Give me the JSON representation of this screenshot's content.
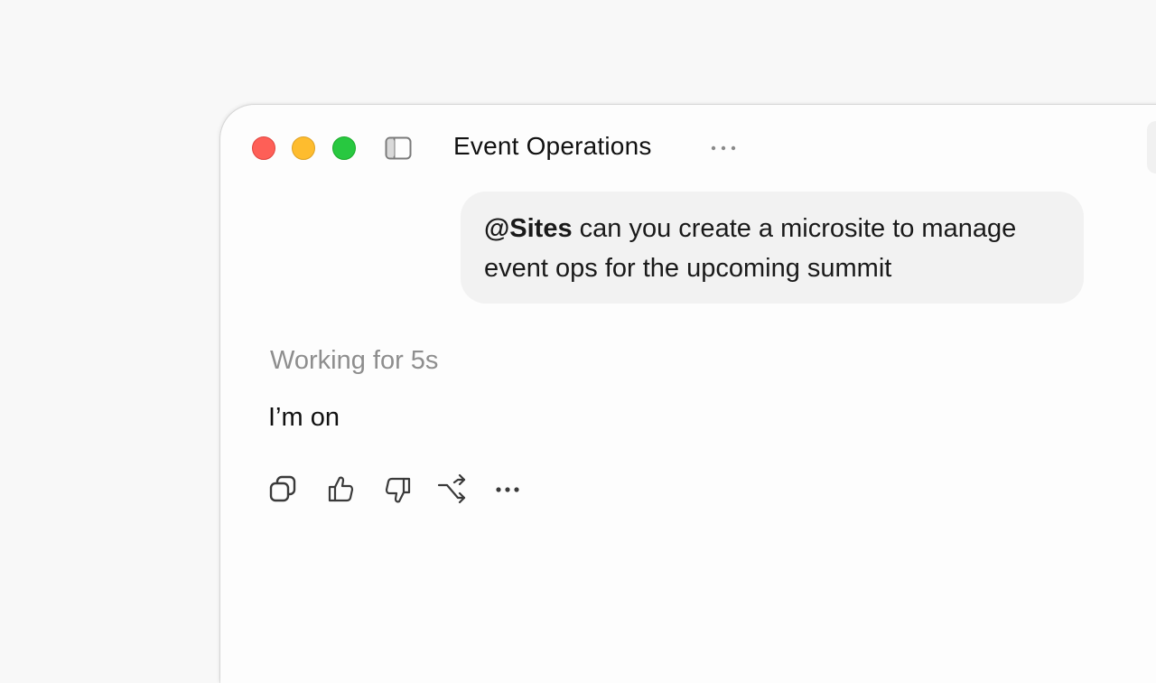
{
  "window": {
    "title": "Event Operations",
    "traffic_lights": {
      "close_color": "#fe5f57",
      "minimize_color": "#febc2e",
      "zoom_color": "#28c840"
    }
  },
  "toolbar": {
    "sidebar_toggle_icon": "sidebar-toggle-icon",
    "more_icon": "ellipsis-icon"
  },
  "conversation": {
    "user_message": {
      "mention": "@Sites",
      "text": " can you create a microsite to manage event ops for the upcoming summit"
    },
    "assistant": {
      "status": "Working for 5s",
      "reply": "I’m on"
    }
  },
  "message_actions": [
    {
      "name": "copy",
      "icon": "copy-icon"
    },
    {
      "name": "thumbs-up",
      "icon": "thumbs-up-icon"
    },
    {
      "name": "thumbs-down",
      "icon": "thumbs-down-icon"
    },
    {
      "name": "branch",
      "icon": "branch-arrow-icon"
    },
    {
      "name": "more",
      "icon": "ellipsis-icon"
    }
  ]
}
